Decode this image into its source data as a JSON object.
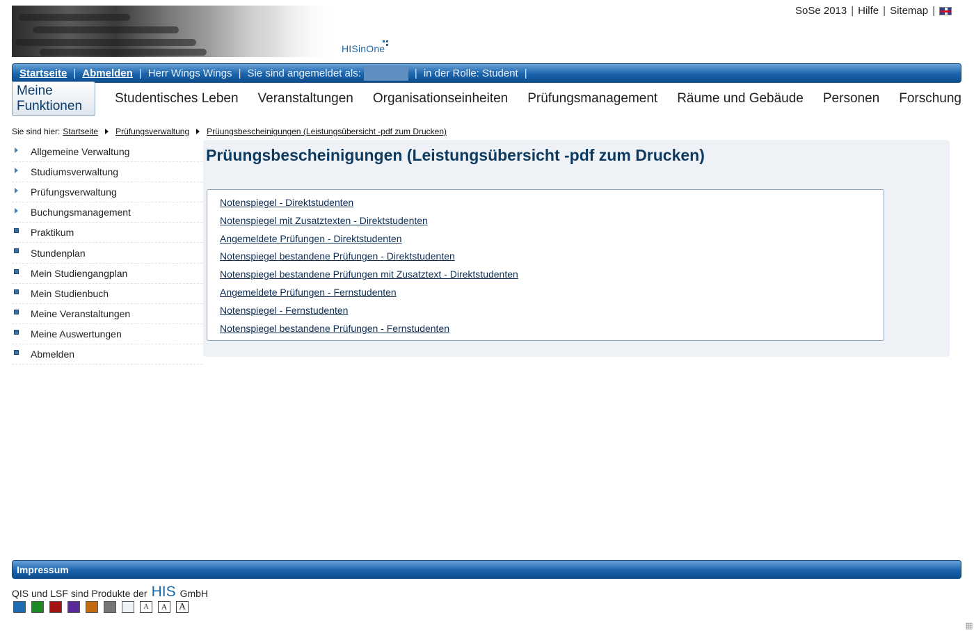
{
  "header": {
    "logo_text": "HISinOne",
    "semester": "SoSe 2013",
    "help": "Hilfe",
    "sitemap": "Sitemap"
  },
  "bluebar": {
    "home": "Startseite",
    "logout": "Abmelden",
    "user": "Herr Wings Wings",
    "logged_in_as": "Sie sind angemeldet als:",
    "role": "in der Rolle: Student"
  },
  "nav": {
    "items": [
      "Meine Funktionen",
      "Studentisches Leben",
      "Veranstaltungen",
      "Organisationseinheiten",
      "Prüfungsmanagement",
      "Räume und Gebäude",
      "Personen",
      "Forschung"
    ]
  },
  "breadcrumb": {
    "prefix": "Sie sind hier:",
    "items": [
      "Startseite",
      "Prüfungsverwaltung",
      "Prüungsbescheinigungen (Leistungsübersicht -pdf zum Drucken)"
    ]
  },
  "sidebar": {
    "items": [
      {
        "label": "Allgemeine Verwaltung",
        "icon": "arrow-icon"
      },
      {
        "label": "Studiumsverwaltung",
        "icon": "arrow-icon"
      },
      {
        "label": "Prüfungsverwaltung",
        "icon": "arrow-icon"
      },
      {
        "label": "Buchungsmanagement",
        "icon": "arrow-icon"
      },
      {
        "label": "Praktikum",
        "icon": "square-icon"
      },
      {
        "label": "Stundenplan",
        "icon": "square-icon"
      },
      {
        "label": "Mein Studiengangplan",
        "icon": "square-icon"
      },
      {
        "label": "Mein Studienbuch",
        "icon": "square-icon"
      },
      {
        "label": "Meine Veranstaltungen",
        "icon": "square-icon"
      },
      {
        "label": "Meine Auswertungen",
        "icon": "square-icon"
      },
      {
        "label": "Abmelden",
        "icon": "square-icon"
      }
    ]
  },
  "main": {
    "title": "Prüungsbescheinigungen (Leistungsübersicht -pdf zum Drucken)",
    "links": [
      "Notenspiegel - Direktstudenten",
      "Notenspiegel mit Zusatztexten - Direktstudenten",
      "Angemeldete Prüfungen - Direktstudenten",
      "Notenspiegel bestandene Prüfungen - Direktstudenten",
      "Notenspiegel bestandene Prüfungen mit Zusatztext - Direktstudenten",
      "Angemeldete Prüfungen - Fernstudenten",
      "Notenspiegel - Fernstudenten",
      "Notenspiegel bestandene Prüfungen - Fernstudenten"
    ]
  },
  "footer": {
    "impressum": "Impressum",
    "text_before": "QIS und LSF sind Produkte der",
    "his": "HIS",
    "text_after": "GmbH",
    "font_size_labels": [
      "A",
      "A",
      "A"
    ],
    "colors": [
      "#1e6db3",
      "#1d8a26",
      "#a31515",
      "#5b2a9a",
      "#c46b12",
      "#777777",
      "#eef3f8"
    ]
  }
}
